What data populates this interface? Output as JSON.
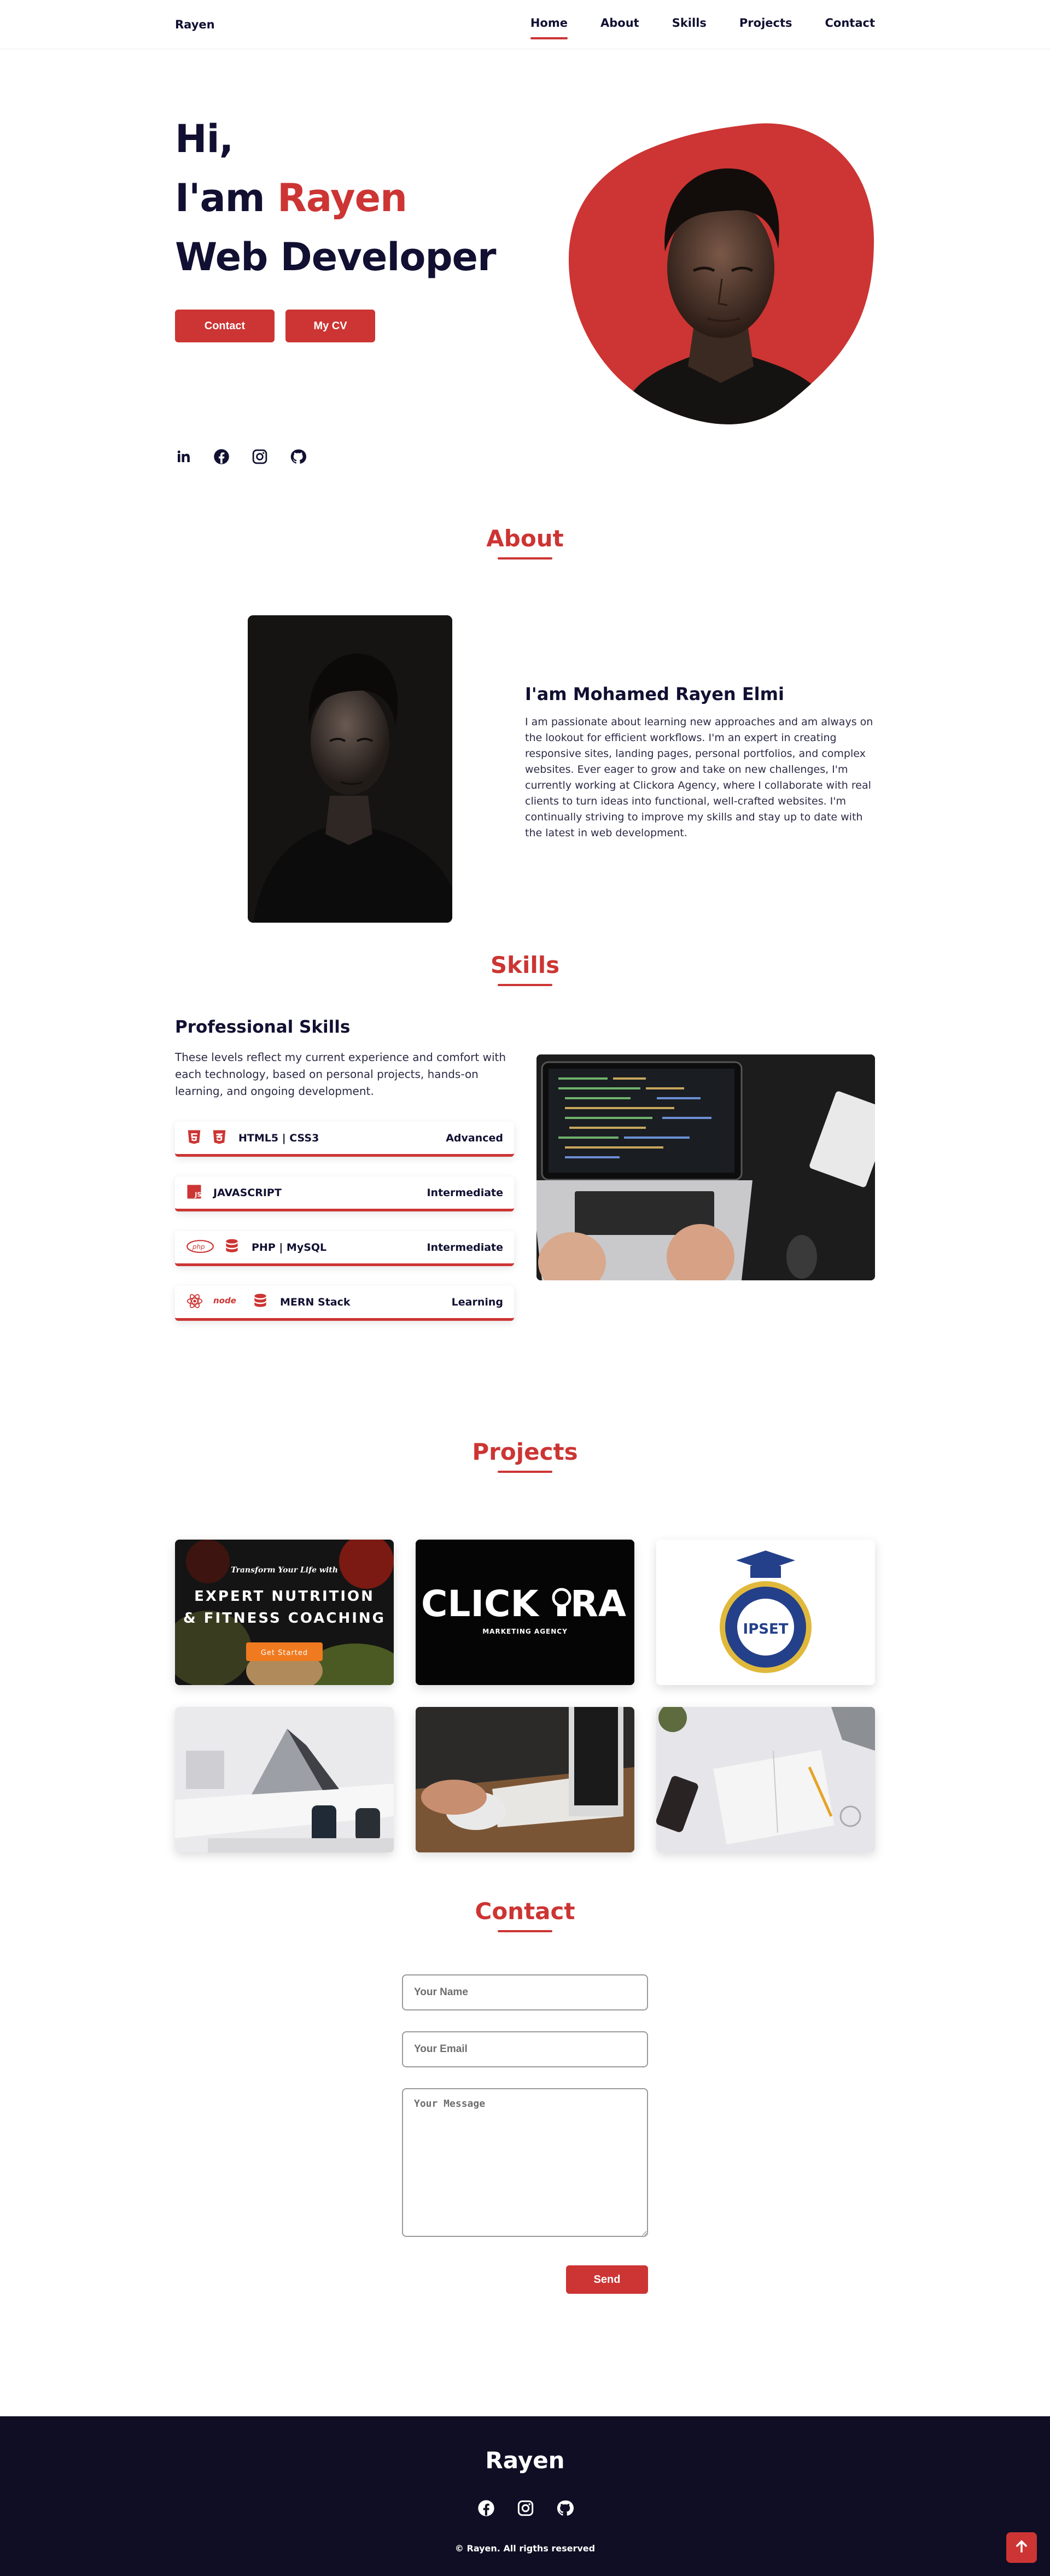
{
  "nav": {
    "brand": "Rayen",
    "links": [
      "Home",
      "About",
      "Skills",
      "Projects",
      "Contact"
    ],
    "active": "Home"
  },
  "hero": {
    "line1": "Hi,",
    "line2_prefix": "I'am ",
    "line2_name": "Rayen",
    "line3": "Web Developer",
    "contact_button": "Contact",
    "cv_button": "My CV",
    "social_icons": [
      "linkedin-icon",
      "facebook-icon",
      "instagram-icon",
      "github-icon"
    ]
  },
  "about": {
    "title": "About",
    "heading": "I'am Mohamed Rayen Elmi",
    "paragraph": "I am passionate about learning new approaches and am always on the lookout for efficient workflows. I'm an expert in creating responsive sites, landing pages, personal portfolios, and complex websites. Ever eager to grow and take on new challenges, I'm currently working at Clickora Agency, where I collaborate with real clients to turn ideas into functional, well-crafted websites. I'm continually striving to improve my skills and stay up to date with the latest in web development."
  },
  "skills": {
    "title": "Skills",
    "heading": "Professional Skills",
    "paragraph": "These levels reflect my current experience and comfort with each technology, based on personal projects, hands-on learning, and ongoing development.",
    "items": [
      {
        "name": "HTML5 | CSS3",
        "level": "Advanced"
      },
      {
        "name": "JAVASCRIPT",
        "level": "Intermediate"
      },
      {
        "name": "PHP | MySQL",
        "level": "Intermediate"
      },
      {
        "name": "MERN Stack",
        "level": "Learning"
      }
    ]
  },
  "projects": {
    "title": "Projects",
    "card1": {
      "tagline": "Transform Your Life with",
      "line1": "EXPERT NUTRITION",
      "line2": "& FITNESS COACHING",
      "cta": "Get Started"
    },
    "card2": {
      "logo": "CLICK",
      "logo_end": "RA",
      "sub": "MARKETING AGENCY"
    },
    "card3": {
      "logo": "IPSET"
    }
  },
  "contact": {
    "title": "Contact",
    "name_placeholder": "Your Name",
    "email_placeholder": "Your Email",
    "message_placeholder": "Your Message",
    "send_button": "Send"
  },
  "footer": {
    "brand": "Rayen",
    "copyright": "© Rayen. All rigths reserved"
  },
  "colors": {
    "accent": "#cc3533",
    "dark": "#111032",
    "footer_bg": "#0f0e24"
  }
}
